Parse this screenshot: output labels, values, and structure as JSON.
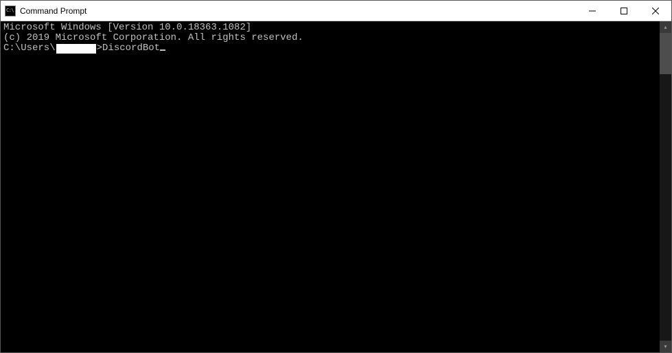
{
  "window": {
    "title": "Command Prompt",
    "icon_text": "C:\\"
  },
  "terminal": {
    "line1": "Microsoft Windows [Version 10.0.18363.1082]",
    "line2": "(c) 2019 Microsoft Corporation. All rights reserved.",
    "blank": "",
    "prompt_prefix": "C:\\Users\\",
    "prompt_suffix": ">",
    "typed": "DiscordBot"
  },
  "scrollbar": {
    "up": "▴",
    "down": "▾"
  }
}
